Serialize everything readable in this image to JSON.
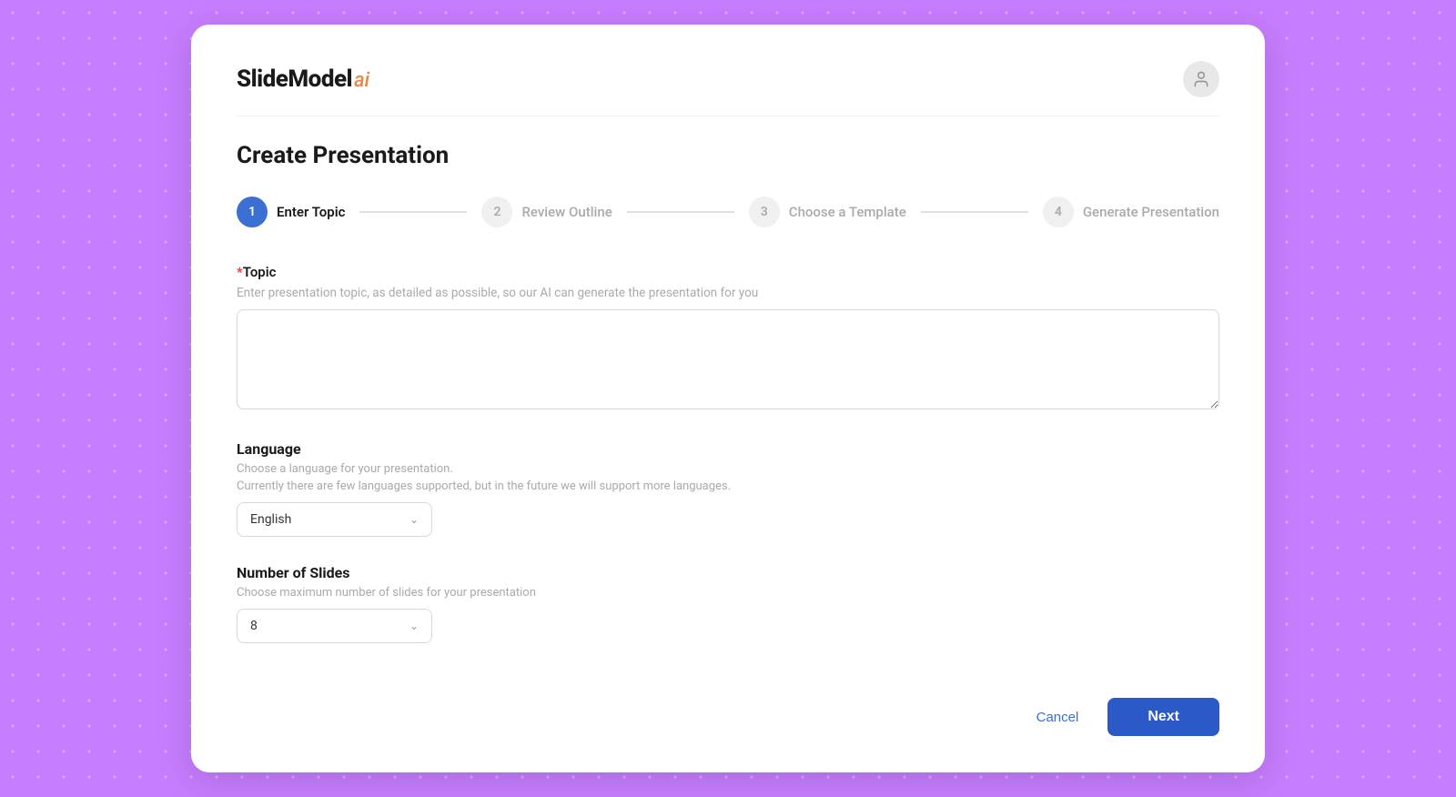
{
  "logo": {
    "bold": "SlideModel",
    "ai": "ai"
  },
  "page_title": "Create Presentation",
  "stepper": {
    "steps": [
      {
        "number": "1",
        "label": "Enter Topic",
        "active": true
      },
      {
        "number": "2",
        "label": "Review Outline",
        "active": false
      },
      {
        "number": "3",
        "label": "Choose a Template",
        "active": false
      },
      {
        "number": "4",
        "label": "Generate Presentation",
        "active": false
      }
    ]
  },
  "topic_field": {
    "label": "*Topic",
    "hint": "Enter presentation topic, as detailed as possible, so our AI can generate the presentation for you",
    "value": "",
    "placeholder": ""
  },
  "language_field": {
    "title": "Language",
    "hint1": "Choose a language for your presentation.",
    "hint2": "Currently there are few languages supported, but in the future we will support more languages.",
    "selected": "English"
  },
  "slides_field": {
    "title": "Number of Slides",
    "hint": "Choose maximum number of slides for your presentation",
    "selected": "8"
  },
  "footer": {
    "cancel_label": "Cancel",
    "next_label": "Next"
  }
}
